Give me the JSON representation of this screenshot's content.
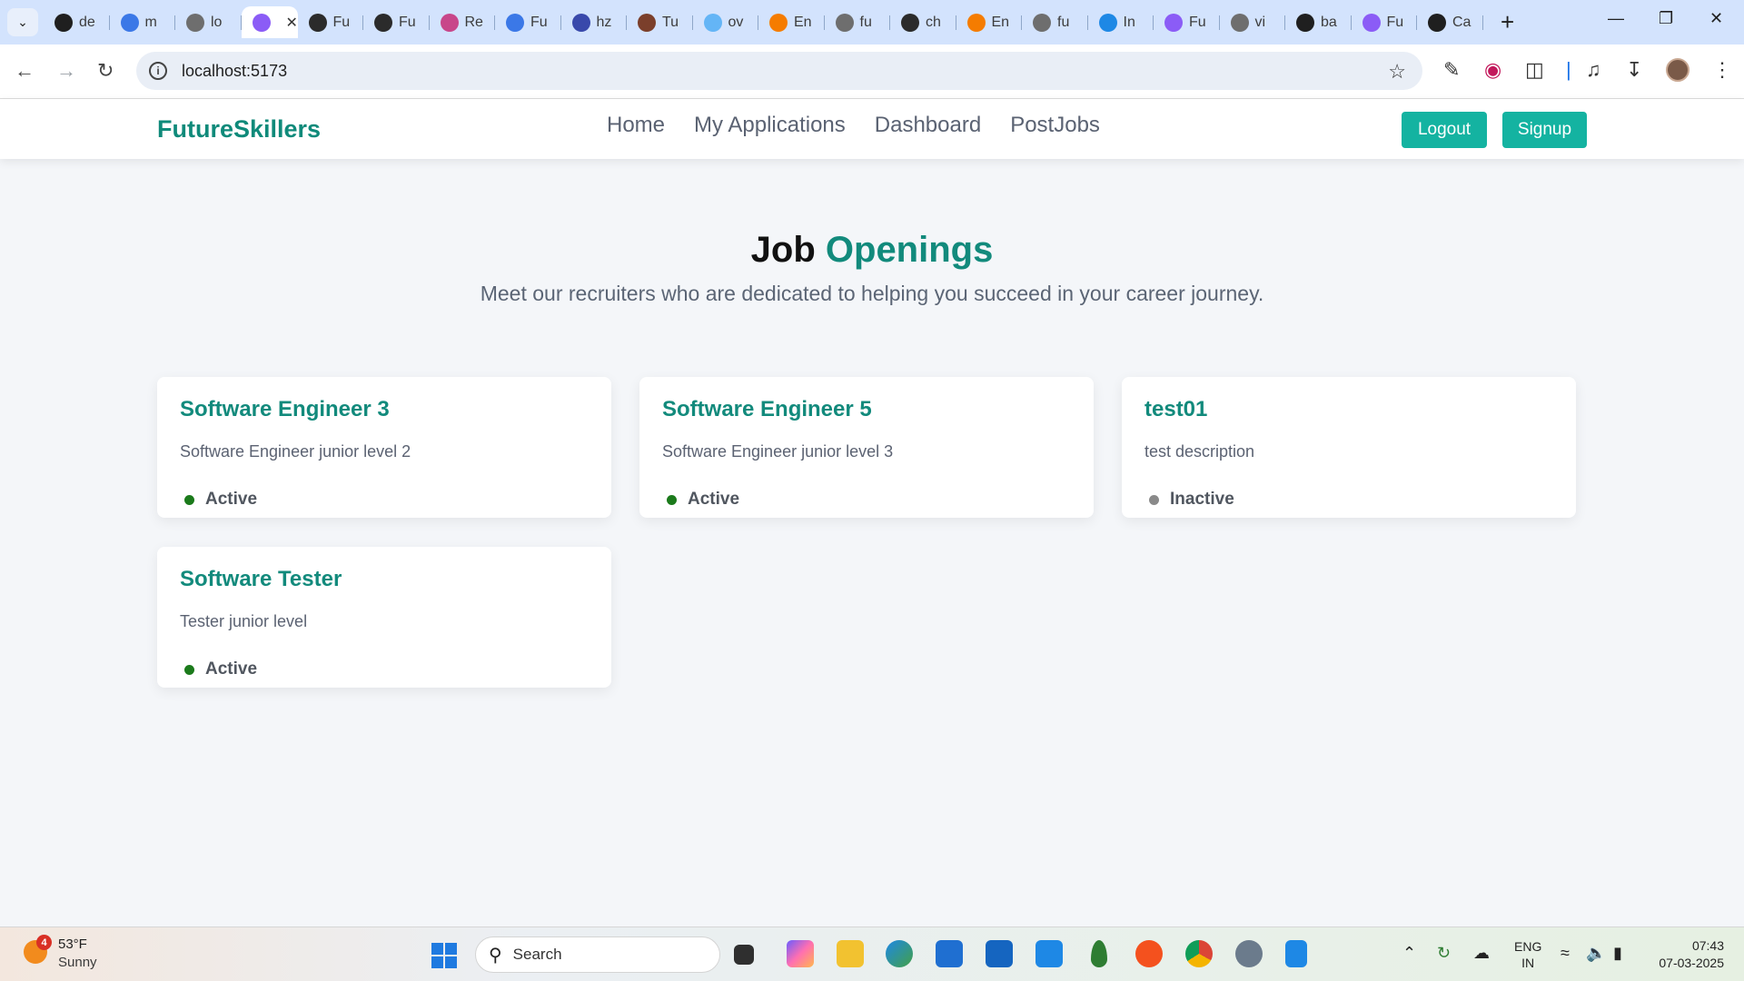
{
  "browser": {
    "tabs": [
      {
        "label": "de",
        "icon": "github-icon",
        "color": "#1f1f1f"
      },
      {
        "label": "m",
        "icon": "docs-icon",
        "color": "#3b78e7"
      },
      {
        "label": "lo",
        "icon": "globe-icon",
        "color": "#6e6e6e"
      },
      {
        "label": "",
        "icon": "vite-icon",
        "color": "#8b5cf6",
        "active": true
      },
      {
        "label": "Fu",
        "icon": "chrome-icon",
        "color": "#2b2b2b"
      },
      {
        "label": "Fu",
        "icon": "chrome-icon",
        "color": "#2b2b2b"
      },
      {
        "label": "Re",
        "icon": "react-icon",
        "color": "#c8468a"
      },
      {
        "label": "Fu",
        "icon": "docs-icon",
        "color": "#3b78e7"
      },
      {
        "label": "hz",
        "icon": "cloud-icon",
        "color": "#3949ab"
      },
      {
        "label": "Tu",
        "icon": "avatar-icon",
        "color": "#7b3f2b"
      },
      {
        "label": "ov",
        "icon": "cloud-icon",
        "color": "#64b5f6"
      },
      {
        "label": "En",
        "icon": "orange-icon",
        "color": "#f57c00"
      },
      {
        "label": "fu",
        "icon": "globe-icon",
        "color": "#6e6e6e"
      },
      {
        "label": "ch",
        "icon": "chrome-icon",
        "color": "#2b2b2b"
      },
      {
        "label": "En",
        "icon": "orange-icon",
        "color": "#f57c00"
      },
      {
        "label": "fu",
        "icon": "globe-icon",
        "color": "#6e6e6e"
      },
      {
        "label": "In",
        "icon": "is-icon",
        "color": "#1e88e5"
      },
      {
        "label": "Fu",
        "icon": "vite-icon",
        "color": "#8b5cf6"
      },
      {
        "label": "vi",
        "icon": "globe-icon",
        "color": "#6e6e6e"
      },
      {
        "label": "ba",
        "icon": "github-icon",
        "color": "#1f1f1f"
      },
      {
        "label": "Fu",
        "icon": "vite-icon",
        "color": "#8b5cf6"
      },
      {
        "label": "Ca",
        "icon": "openai-icon",
        "color": "#1f1f1f"
      }
    ],
    "url": "localhost:5173"
  },
  "nav": {
    "brand": "FutureSkillers",
    "links": [
      "Home",
      "My Applications",
      "Dashboard",
      "PostJobs"
    ],
    "logout": "Logout",
    "signup": "Signup"
  },
  "page": {
    "title_part1": "Job",
    "title_part2": "Openings",
    "subtitle": "Meet our recruiters who are dedicated to helping you succeed in your career journey."
  },
  "jobs": [
    {
      "title": "Software Engineer 3",
      "description": "Software Engineer junior level 2",
      "status": "Active",
      "active": true
    },
    {
      "title": "Software Engineer 5",
      "description": "Software Engineer junior level 3",
      "status": "Active",
      "active": true
    },
    {
      "title": "test01",
      "description": "test description",
      "status": "Inactive",
      "active": false
    },
    {
      "title": "Software Tester",
      "description": "Tester junior level",
      "status": "Active",
      "active": true
    }
  ],
  "taskbar": {
    "weather_temp": "53°F",
    "weather_cond": "Sunny",
    "weather_badge": "4",
    "search": "Search",
    "lang_line1": "ENG",
    "lang_line2": "IN",
    "time": "07:43",
    "date": "07-03-2025"
  },
  "colors": {
    "brand": "#0f8a7a",
    "button": "#14b3a1",
    "active_dot": "#1b7a1b",
    "inactive_dot": "#8a8a8a"
  }
}
